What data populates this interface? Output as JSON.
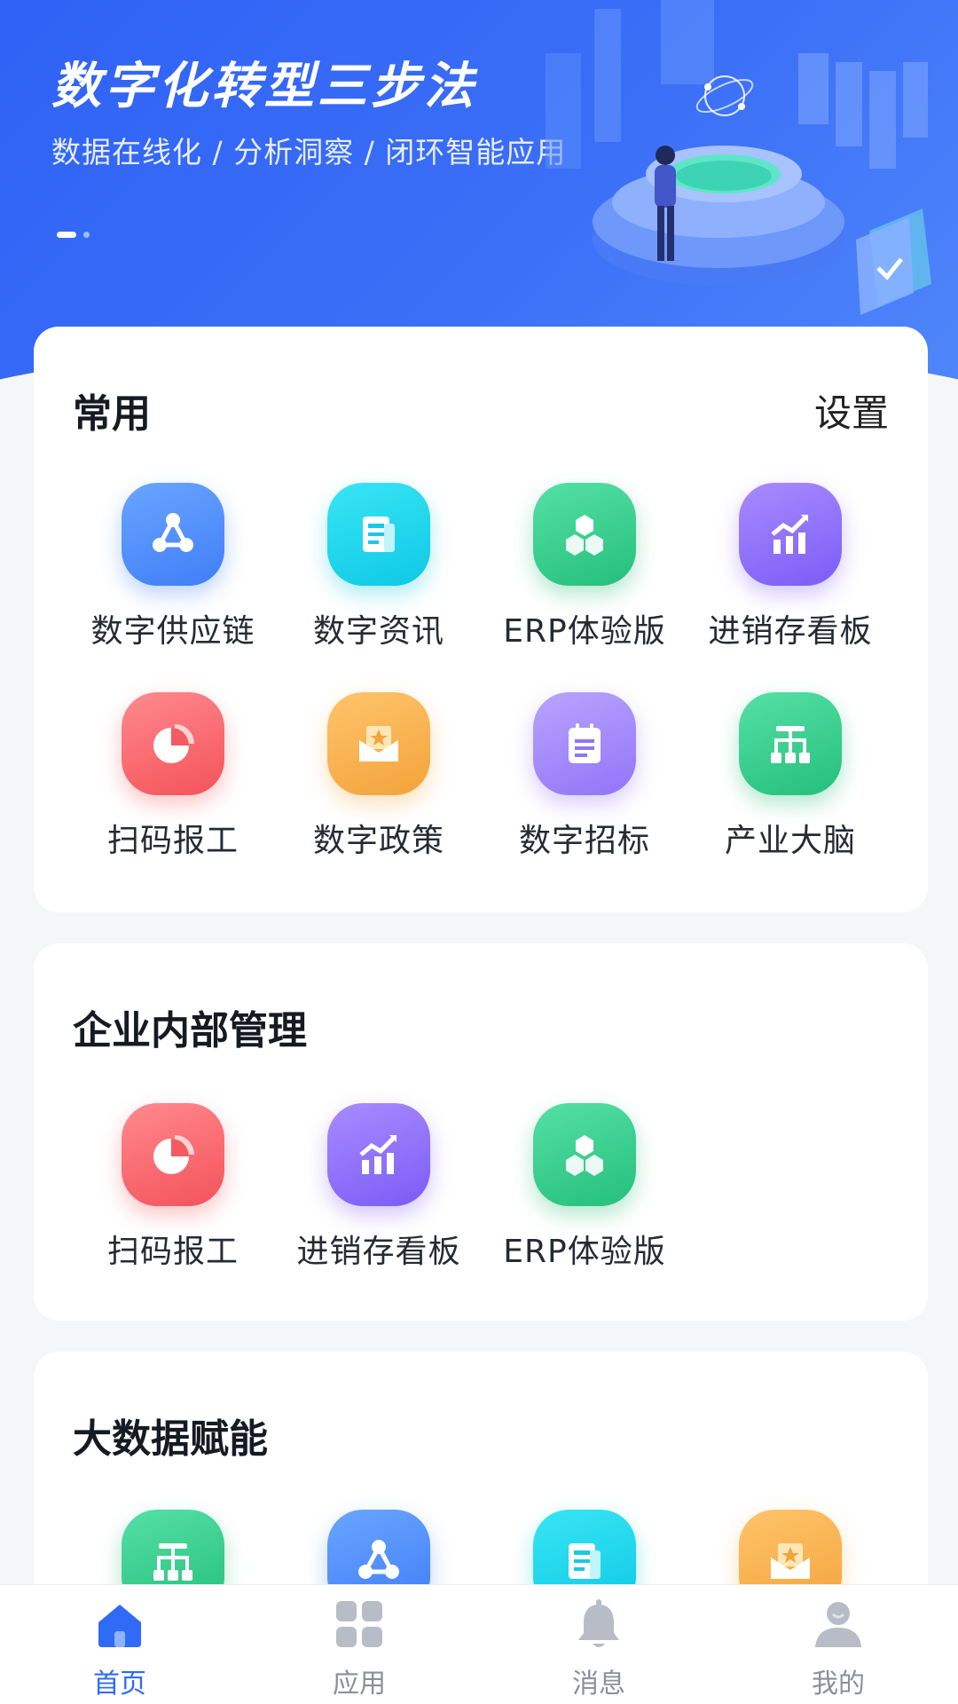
{
  "banner": {
    "title": "数字化转型三步法",
    "subtitle": "数据在线化 / 分析洞察 / 闭环智能应用"
  },
  "common": {
    "title": "常用",
    "settings_label": "设置",
    "apps": [
      {
        "label": "数字供应链",
        "icon": "network-icon",
        "color": "#4f8dfa"
      },
      {
        "label": "数字资讯",
        "icon": "news-icon",
        "color": "#12cbe7"
      },
      {
        "label": "ERP体验版",
        "icon": "cubes-icon",
        "color": "#2ec486"
      },
      {
        "label": "进销存看板",
        "icon": "chart-icon",
        "color": "#8462f7"
      },
      {
        "label": "扫码报工",
        "icon": "pie-icon",
        "color": "#f55a61"
      },
      {
        "label": "数字政策",
        "icon": "envelope-icon",
        "color": "#f4a63f"
      },
      {
        "label": "数字招标",
        "icon": "clipboard-icon",
        "color": "#987af8"
      },
      {
        "label": "产业大脑",
        "icon": "hierarchy-icon",
        "color": "#2ec486"
      }
    ]
  },
  "internal": {
    "title": "企业内部管理",
    "apps": [
      {
        "label": "扫码报工",
        "icon": "pie-icon",
        "color": "#f55a61"
      },
      {
        "label": "进销存看板",
        "icon": "chart-icon",
        "color": "#8462f7"
      },
      {
        "label": "ERP体验版",
        "icon": "cubes-icon",
        "color": "#2ec486"
      }
    ]
  },
  "bigdata": {
    "title": "大数据赋能",
    "apps": [
      {
        "icon": "hierarchy-icon",
        "color": "#2ec486"
      },
      {
        "icon": "network-icon",
        "color": "#4f8dfa"
      },
      {
        "icon": "news-icon",
        "color": "#12cbe7"
      },
      {
        "icon": "envelope-icon",
        "color": "#f4a63f"
      }
    ]
  },
  "tabbar": {
    "home": "首页",
    "apps": "应用",
    "messages": "消息",
    "mine": "我的",
    "active_color": "#2f6bf6"
  }
}
